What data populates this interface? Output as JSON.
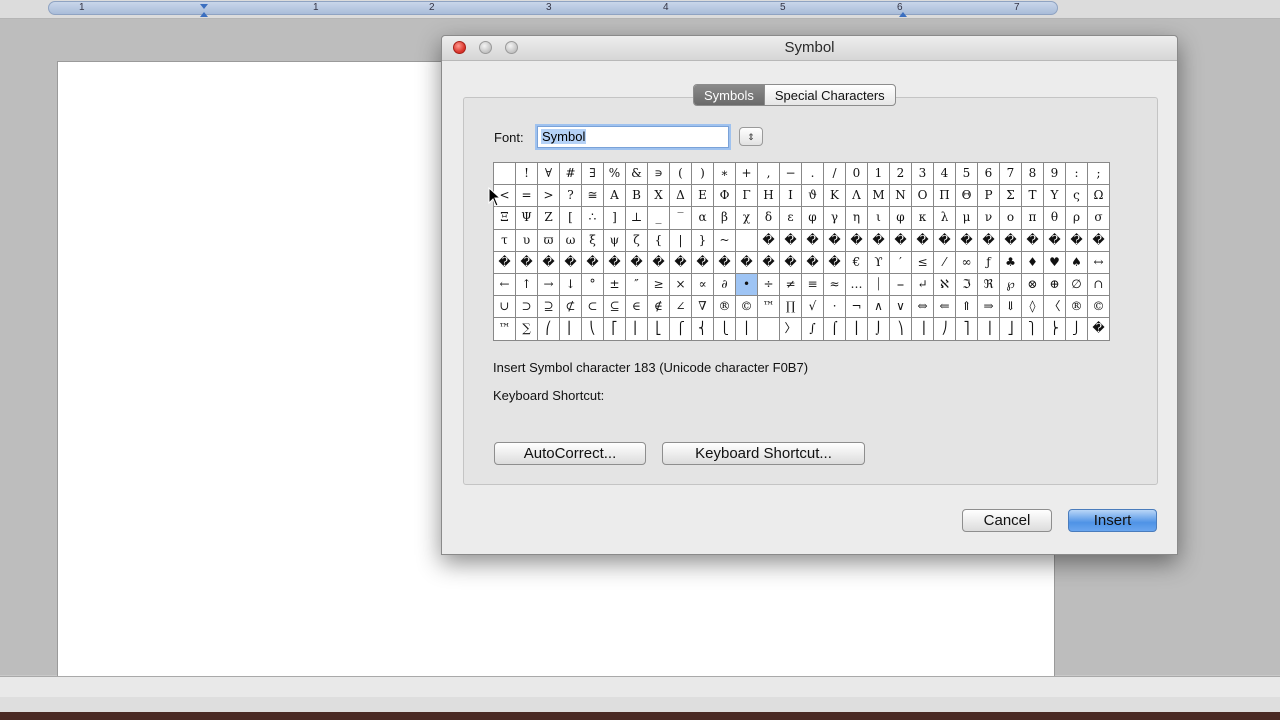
{
  "ruler": {
    "numbers": [
      "1",
      "1",
      "2",
      "3",
      "4",
      "5",
      "6",
      "7"
    ]
  },
  "dialog": {
    "title": "Symbol",
    "tabs": [
      {
        "label": "Symbols",
        "active": true
      },
      {
        "label": "Special Characters",
        "active": false
      }
    ],
    "font_label": "Font:",
    "font_value": "Symbol",
    "stepper_icon": "⇕",
    "symbol_grid": [
      [
        " ",
        "!",
        "∀",
        "#",
        "∃",
        "%",
        "&",
        "∍",
        "(",
        ")",
        "∗",
        "+",
        ",",
        "−",
        ".",
        "/",
        "0",
        "1",
        "2",
        "3",
        "4",
        "5",
        "6",
        "7",
        "8",
        "9",
        ":",
        ";"
      ],
      [
        "<",
        "=",
        ">",
        "?",
        "≅",
        "Α",
        "Β",
        "Χ",
        "Δ",
        "Ε",
        "Φ",
        "Γ",
        "Η",
        "Ι",
        "ϑ",
        "Κ",
        "Λ",
        "Μ",
        "Ν",
        "Ο",
        "Π",
        "Θ",
        "Ρ",
        "Σ",
        "Τ",
        "Υ",
        "ς",
        "Ω"
      ],
      [
        "Ξ",
        "Ψ",
        "Ζ",
        "[",
        "∴",
        "]",
        "⊥",
        "_",
        "‾",
        "α",
        "β",
        "χ",
        "δ",
        "ε",
        "φ",
        "γ",
        "η",
        "ι",
        "φ",
        "κ",
        "λ",
        "μ",
        "ν",
        "ο",
        "π",
        "θ",
        "ρ",
        "σ"
      ],
      [
        "τ",
        "υ",
        "ϖ",
        "ω",
        "ξ",
        "ψ",
        "ζ",
        "{",
        "|",
        "}",
        "~",
        "",
        "�",
        "�",
        "�",
        "�",
        "�",
        "�",
        "�",
        "�",
        "�",
        "�",
        "�",
        "�",
        "�",
        "�",
        "�",
        "�"
      ],
      [
        "�",
        "�",
        "�",
        "�",
        "�",
        "�",
        "�",
        "�",
        "�",
        "�",
        "�",
        "�",
        "�",
        "�",
        "�",
        "�",
        "€",
        "ϒ",
        "′",
        "≤",
        "⁄",
        "∞",
        "ƒ",
        "♣",
        "♦",
        "♥",
        "♠",
        "↔"
      ],
      [
        "←",
        "↑",
        "→",
        "↓",
        "°",
        "±",
        "″",
        "≥",
        "×",
        "∝",
        "∂",
        "•",
        "÷",
        "≠",
        "≡",
        "≈",
        "…",
        "⏐",
        "⎯",
        "↵",
        "ℵ",
        "ℑ",
        "ℜ",
        "℘",
        "⊗",
        "⊕",
        "∅",
        "∩"
      ],
      [
        "∪",
        "⊃",
        "⊇",
        "⊄",
        "⊂",
        "⊆",
        "∈",
        "∉",
        "∠",
        "∇",
        "®",
        "©",
        "™",
        "∏",
        "√",
        "⋅",
        "¬",
        "∧",
        "∨",
        "⇔",
        "⇐",
        "⇑",
        "⇒",
        "⇓",
        "◊",
        "〈",
        "®",
        "©"
      ],
      [
        "™",
        "∑",
        "⎛",
        "⎜",
        "⎝",
        "⎡",
        "⎢",
        "⎣",
        "⎧",
        "⎨",
        "⎩",
        "⎪",
        "",
        "〉",
        "∫",
        "⌠",
        "⎮",
        "⌡",
        "⎞",
        "⎟",
        "⎠",
        "⎤",
        "⎥",
        "⎦",
        "⎫",
        "⎬",
        "⎭",
        "�"
      ]
    ],
    "selected_symbol": "•",
    "insert_info": "Insert Symbol character 183  (Unicode character F0B7)",
    "keyboard_shortcut_label": "Keyboard Shortcut:",
    "autocorrect_button": "AutoCorrect...",
    "keyboard_shortcut_button": "Keyboard Shortcut...",
    "cancel_button": "Cancel",
    "insert_button": "Insert"
  }
}
